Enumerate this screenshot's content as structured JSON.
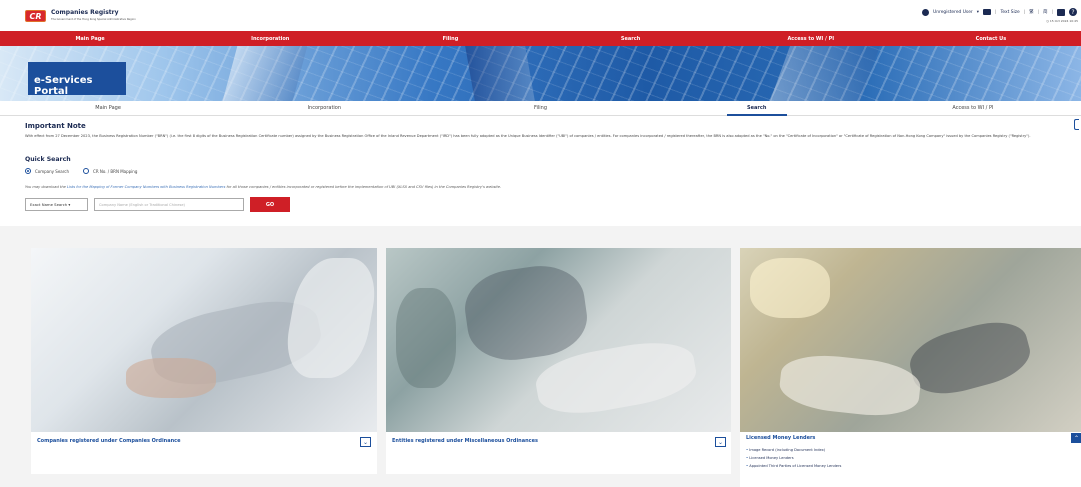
{
  "header": {
    "logo_text": "CR",
    "title": "Companies Registry",
    "subtitle": "The Government of the Hong Kong Special Administrative Region",
    "user_label": "Unregistered User",
    "text_size_label": "Text Size",
    "date_text": "15 Oct 2024 10:45"
  },
  "red_nav": [
    "Main Page",
    "Incorporation",
    "Filing",
    "Search",
    "Access to WI / PI",
    "Contact Us"
  ],
  "banner": {
    "portal_title": "e-Services Portal"
  },
  "sub_nav": {
    "items": [
      "Main Page",
      "Incorporation",
      "Filing",
      "Search",
      "Access to WI / PI"
    ],
    "active_index": 3
  },
  "important_note": {
    "title": "Important Note",
    "text": "With effect from 27 December 2023, the Business Registration Number (\"BRN\") (i.e. the first 8 digits of the Business Registration Certificate number) assigned by the Business Registration Office of the Inland Revenue Department (\"IRD\") has been fully adopted as the Unique Business Identifier (\"UBI\") of companies / entities. For companies incorporated / registered thereafter, the BRN is also adopted as the \"No.\" on the \"Certificate of Incorporation\" or \"Certificate of Registration of Non-Hong Kong Company\" issued by the Companies Registry (\"Registry\")."
  },
  "quick_search": {
    "title": "Quick Search",
    "radio_company": "Company Search",
    "radio_mapping": "CR No. / BRN Mapping",
    "download_prefix": "You may download the ",
    "download_link": "Lists for the Mapping of Former Company Numbers with Business Registration Numbers",
    "download_suffix": " for all those companies / entities incorporated or registered before the implementation of UBI (XLSX and CSV files) in the Companies Registry's website.",
    "select_value": "Exact Name Search",
    "input_placeholder": "Company Name (English or Traditional Chinese)",
    "go_label": "GO"
  },
  "cards": [
    {
      "caption": "Companies registered under Companies Ordinance",
      "chevron": "⌄"
    },
    {
      "caption": "Entities registered under Miscellaneous Ordinances",
      "chevron": "⌄"
    },
    {
      "caption": "Licensed Money Lenders",
      "chevron": "⌃",
      "links": [
        "Image Record (including Document Index)",
        "Licensed Money Lenders",
        "Appointed Third Parties of Licensed Money Lenders"
      ]
    }
  ],
  "colors": {
    "brand_red": "#cf1f26",
    "brand_blue": "#1c4f9c",
    "navy": "#1b2a52"
  }
}
